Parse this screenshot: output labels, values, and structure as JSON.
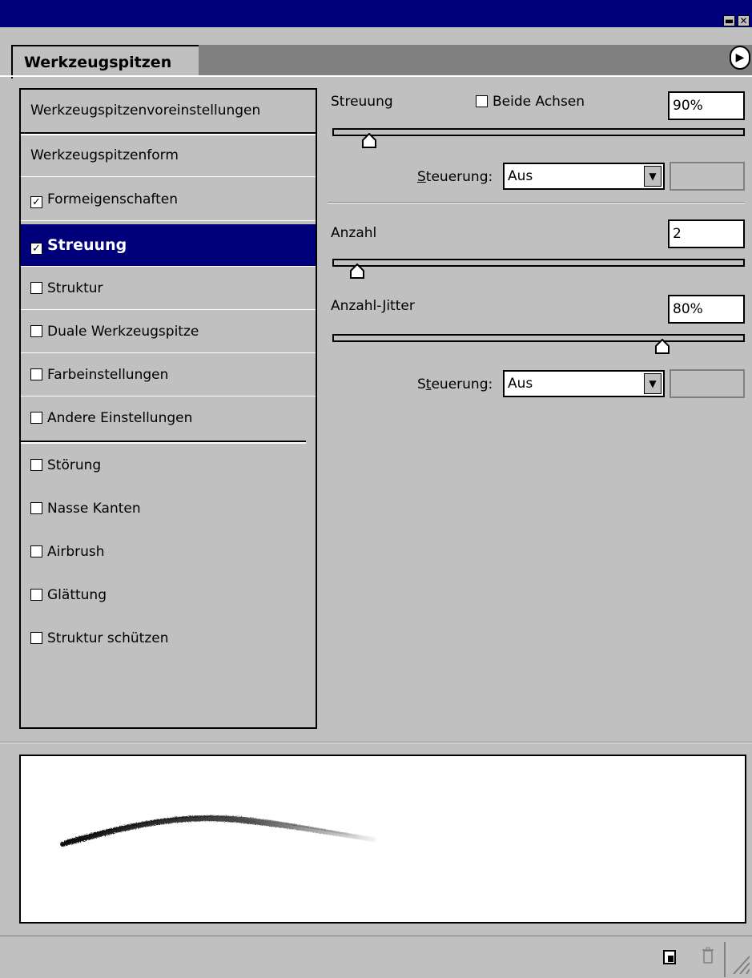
{
  "window": {
    "minimize_glyph": "▬",
    "close_glyph": "✕"
  },
  "tab": {
    "title": "Werkzeugspitzen",
    "menu_glyph": "▶"
  },
  "left_list": {
    "presets": "Werkzeugspitzenvoreinstellungen",
    "items": [
      {
        "label": "Werkzeugspitzenform",
        "checkbox": false,
        "checked": false
      },
      {
        "label": "Formeigenschaften",
        "checkbox": true,
        "checked": true
      },
      {
        "label": "Streuung",
        "checkbox": true,
        "checked": true,
        "selected": true
      },
      {
        "label": "Struktur",
        "checkbox": true,
        "checked": false
      },
      {
        "label": "Duale Werkzeugspitze",
        "checkbox": true,
        "checked": false
      },
      {
        "label": "Farbeinstellungen",
        "checkbox": true,
        "checked": false
      },
      {
        "label": "Andere Einstellungen",
        "checkbox": true,
        "checked": false
      },
      {
        "label": "Störung",
        "checkbox": true,
        "checked": false
      },
      {
        "label": "Nasse Kanten",
        "checkbox": true,
        "checked": false
      },
      {
        "label": "Airbrush",
        "checkbox": true,
        "checked": false
      },
      {
        "label": "Glättung",
        "checkbox": true,
        "checked": false
      },
      {
        "label": "Struktur schützen",
        "checkbox": true,
        "checked": false
      }
    ]
  },
  "settings": {
    "streuung": {
      "label": "Streuung",
      "both_axes_label": "Beide Achsen",
      "both_axes_checked": false,
      "value": "90%",
      "slider_fraction": 0.09
    },
    "control1": {
      "label_pre": "",
      "label_accel": "S",
      "label_post": "teuerung:",
      "value": "Aus"
    },
    "anzahl": {
      "label": "Anzahl",
      "value": "2",
      "slider_fraction": 0.06
    },
    "anzahl_jitter": {
      "label": "Anzahl-Jitter",
      "value": "80%",
      "slider_fraction": 0.8
    },
    "control2": {
      "label_pre": "S",
      "label_accel": "t",
      "label_post": "euerung:",
      "value": "Aus"
    }
  },
  "icons": {
    "checkmark": "✓",
    "dropdown": "▼"
  }
}
